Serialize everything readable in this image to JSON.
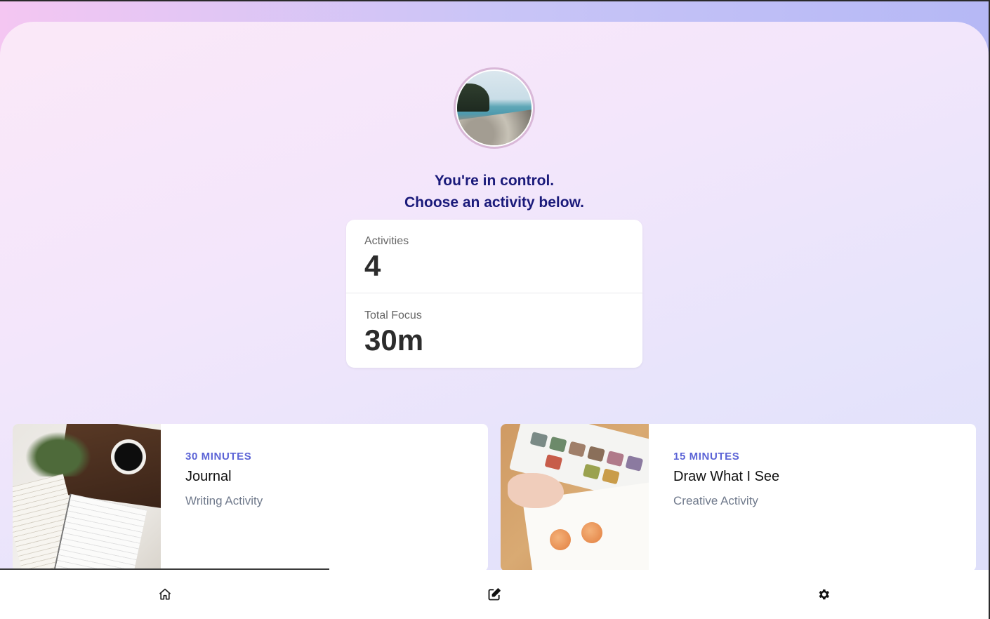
{
  "header": {
    "avatar_icon": "beach-photo",
    "headline_line1": "You're in control.",
    "headline_line2": "Choose an activity below."
  },
  "stats": [
    {
      "label": "Activities",
      "value": "4"
    },
    {
      "label": "Total Focus",
      "value": "30m"
    }
  ],
  "activities": [
    {
      "duration": "30 MINUTES",
      "title": "Journal",
      "category": "Writing Activity",
      "image_icon": "journal-photo"
    },
    {
      "duration": "15 MINUTES",
      "title": "Draw What I See",
      "category": "Creative Activity",
      "image_icon": "watercolor-photo"
    }
  ],
  "tabbar": {
    "tabs": [
      {
        "icon": "home-icon",
        "active": true
      },
      {
        "icon": "edit-icon",
        "active": false
      },
      {
        "icon": "gear-icon",
        "active": false
      }
    ]
  },
  "colors": {
    "accent": "#5b63d6",
    "headline": "#1a1a7a",
    "gradient_start": "#f4c6f2",
    "gradient_end": "#b5b8f5"
  }
}
